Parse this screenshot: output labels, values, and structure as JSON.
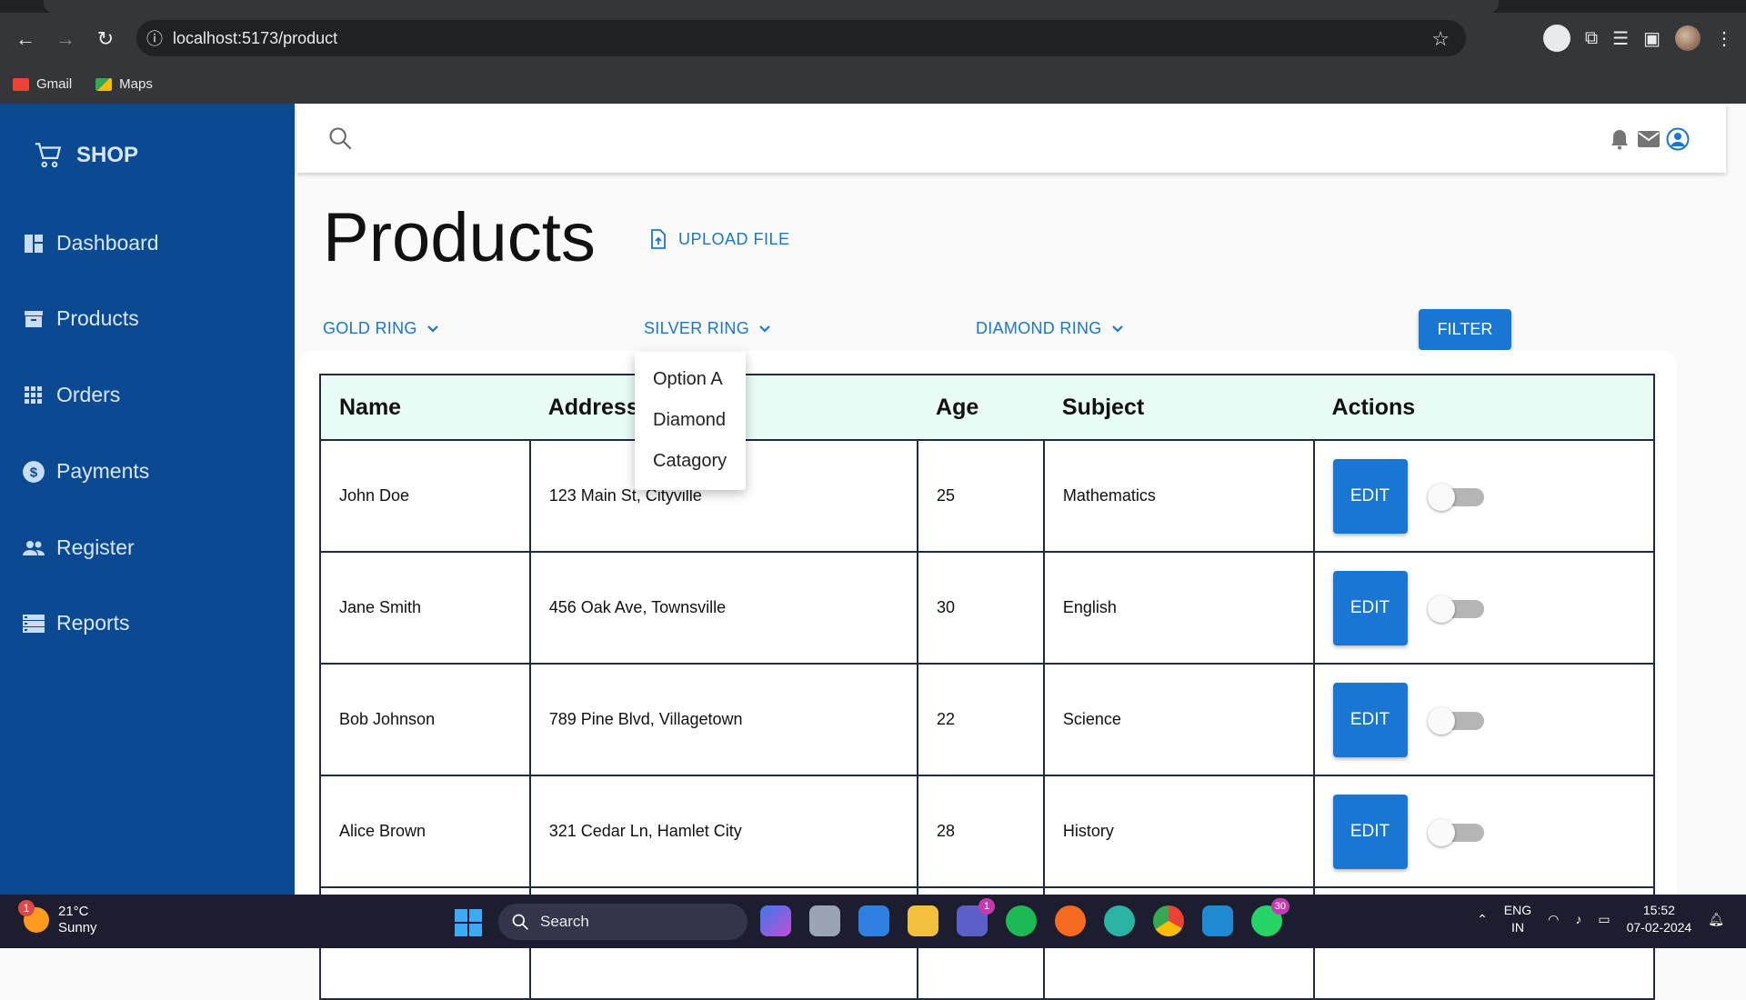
{
  "browser": {
    "url": "localhost:5173/product",
    "bookmarks": [
      {
        "label": "Gmail"
      },
      {
        "label": "Maps"
      }
    ]
  },
  "sidebar": {
    "brand": "SHOP",
    "items": [
      {
        "label": "Dashboard",
        "icon": "dashboard-icon"
      },
      {
        "label": "Products",
        "icon": "archive-icon"
      },
      {
        "label": "Orders",
        "icon": "apps-grid-icon"
      },
      {
        "label": "Payments",
        "icon": "dollar-icon"
      },
      {
        "label": "Register",
        "icon": "people-icon"
      },
      {
        "label": "Reports",
        "icon": "storage-icon"
      }
    ]
  },
  "page": {
    "title": "Products",
    "upload_label": "UPLOAD FILE",
    "filters": [
      {
        "label": "GOLD RING"
      },
      {
        "label": "SILVER RING"
      },
      {
        "label": "DIAMOND RING"
      }
    ],
    "filter_button": "FILTER",
    "open_menu_options": [
      "Option A",
      "Diamond",
      "Catagory"
    ]
  },
  "table": {
    "headers": [
      "Name",
      "Address",
      "Age",
      "Subject",
      "Actions"
    ],
    "edit_label": "EDIT",
    "rows": [
      {
        "name": "John Doe",
        "address": "123 Main St, Cityville",
        "age": "25",
        "subject": "Mathematics"
      },
      {
        "name": "Jane Smith",
        "address": "456 Oak Ave, Townsville",
        "age": "30",
        "subject": "English"
      },
      {
        "name": "Bob Johnson",
        "address": "789 Pine Blvd, Villagetown",
        "age": "22",
        "subject": "Science"
      },
      {
        "name": "Alice Brown",
        "address": "321 Cedar Ln, Hamlet City",
        "age": "28",
        "subject": "History"
      }
    ]
  },
  "taskbar": {
    "weather_temp": "21°C",
    "weather_desc": "Sunny",
    "weather_badge": "1",
    "search_label": "Search",
    "teams_badge": "1",
    "whatsapp_badge": "30",
    "lang_line1": "ENG",
    "lang_line2": "IN",
    "time": "15:52",
    "date": "07-02-2024"
  },
  "colors": {
    "sidebar": "#0b4a93",
    "accent": "#1976d2",
    "header_row": "#e8fbf5"
  }
}
